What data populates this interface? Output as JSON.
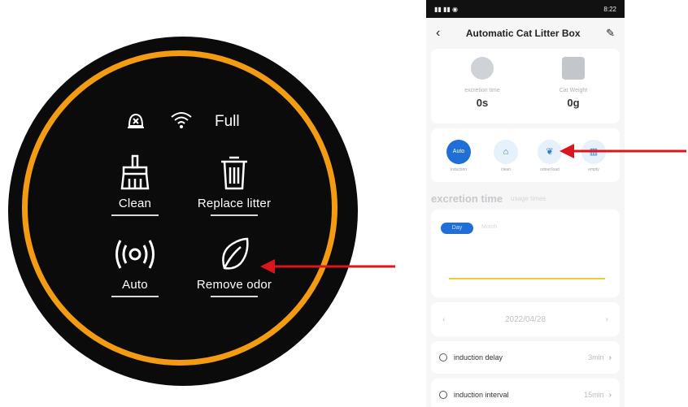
{
  "device": {
    "status_text": "Full",
    "tiles": [
      {
        "label": "Clean"
      },
      {
        "label": "Replace litter"
      },
      {
        "label": "Auto"
      },
      {
        "label": "Remove odor"
      }
    ],
    "accent_ring": "#f39c12"
  },
  "arrows_color": "#d9161d",
  "phone": {
    "status_time": "8:22",
    "title": "Automatic Cat Litter Box",
    "stats": [
      {
        "label": "excretion time",
        "value": "0s"
      },
      {
        "label": "Cat Weight",
        "value": "0g"
      }
    ],
    "modes": [
      {
        "label": "induction",
        "icon_text": "Auto"
      },
      {
        "label": "clean"
      },
      {
        "label": "odour/load"
      },
      {
        "label": "empty"
      }
    ],
    "section": {
      "primary": "excretion time",
      "secondary": "usage times"
    },
    "chart_tabs": {
      "day": "Day",
      "month": "Month"
    },
    "date": "2022/04/28",
    "settings": [
      {
        "name": "induction delay",
        "value": "3min"
      },
      {
        "name": "induction interval",
        "value": "15min"
      }
    ],
    "accent": "#1f6fd6"
  }
}
